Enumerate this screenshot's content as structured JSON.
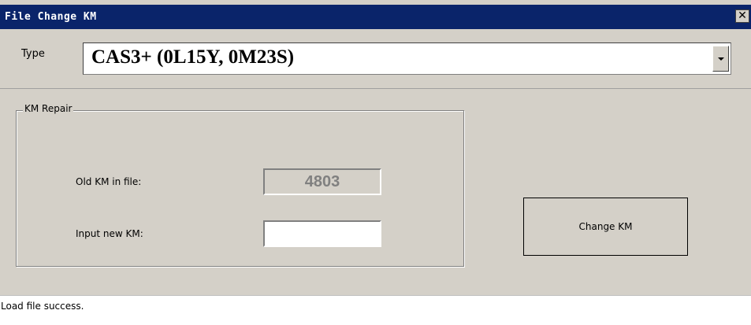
{
  "window": {
    "title": "File Change KM",
    "close_symbol": "✕"
  },
  "type_selector": {
    "label": "Type",
    "selected": "CAS3+ (0L15Y, 0M23S)"
  },
  "km_repair": {
    "legend": "KM Repair",
    "old_label": "Old KM in file:",
    "old_value": "4803",
    "new_label": "Input new KM:",
    "new_value": ""
  },
  "buttons": {
    "change_label": "Change KM"
  },
  "status": {
    "text": "Load file success."
  },
  "icons": {
    "close": "close-icon",
    "dropdown": "chevron-down-icon"
  },
  "colors": {
    "titlebar": "#0a246a",
    "window_bg": "#d4d0c8"
  }
}
